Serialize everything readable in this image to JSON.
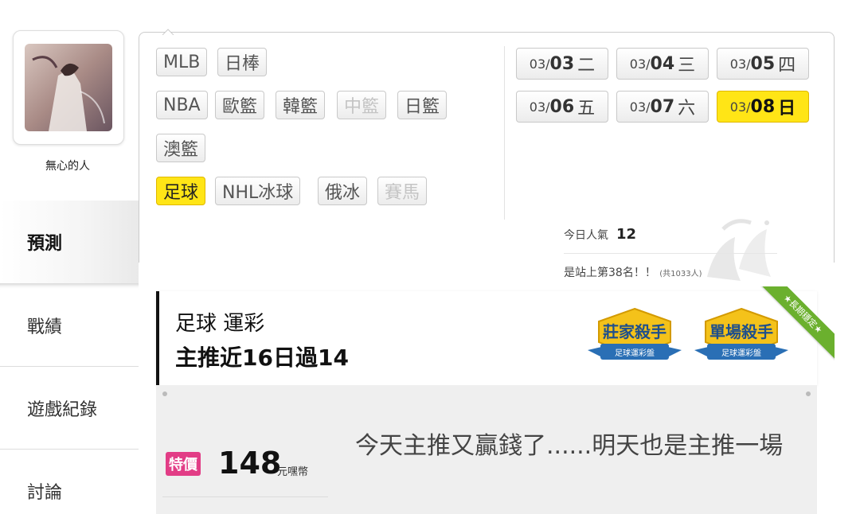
{
  "user": {
    "name": "無心的人"
  },
  "nav": {
    "items": [
      {
        "label": "預測"
      },
      {
        "label": "戰績"
      },
      {
        "label": "遊戲紀錄"
      },
      {
        "label": "討論"
      }
    ]
  },
  "leagues": [
    {
      "label": "MLB"
    },
    {
      "label": "日棒"
    },
    {
      "label": "NBA"
    },
    {
      "label": "歐籃"
    },
    {
      "label": "韓籃"
    },
    {
      "label": "中籃"
    },
    {
      "label": "日籃"
    },
    {
      "label": "澳籃"
    },
    {
      "label": "足球"
    },
    {
      "label": "NHL冰球"
    },
    {
      "label": "俄冰"
    },
    {
      "label": "賽馬"
    }
  ],
  "dates": [
    {
      "month": "03/",
      "day": "03",
      "weekday": "二"
    },
    {
      "month": "03/",
      "day": "04",
      "weekday": "三"
    },
    {
      "month": "03/",
      "day": "05",
      "weekday": "四"
    },
    {
      "month": "03/",
      "day": "06",
      "weekday": "五"
    },
    {
      "month": "03/",
      "day": "07",
      "weekday": "六"
    },
    {
      "month": "03/",
      "day": "08",
      "weekday": "日"
    }
  ],
  "popularity": {
    "label": "今日人氣",
    "value": "12",
    "rank_text": "是站上第38名！！",
    "total": "(共1033人)"
  },
  "title": {
    "line1": "足球 運彩",
    "line2": "主推近16日過14"
  },
  "badges": [
    {
      "title": "莊家殺手",
      "sub": "足球運彩盤"
    },
    {
      "title": "單場殺手",
      "sub": "足球運彩盤"
    }
  ],
  "ribbon": "★長期穩定★",
  "offer": {
    "tag": "特價",
    "price": "148",
    "unit": "元嘿幣",
    "description": "今天主推又贏錢了......明天也是主推一場"
  },
  "colors": {
    "selected": "#ffe516",
    "sale": "#e23d86",
    "badge_gold": "#f4c21a",
    "badge_blue": "#2a6fb5"
  }
}
